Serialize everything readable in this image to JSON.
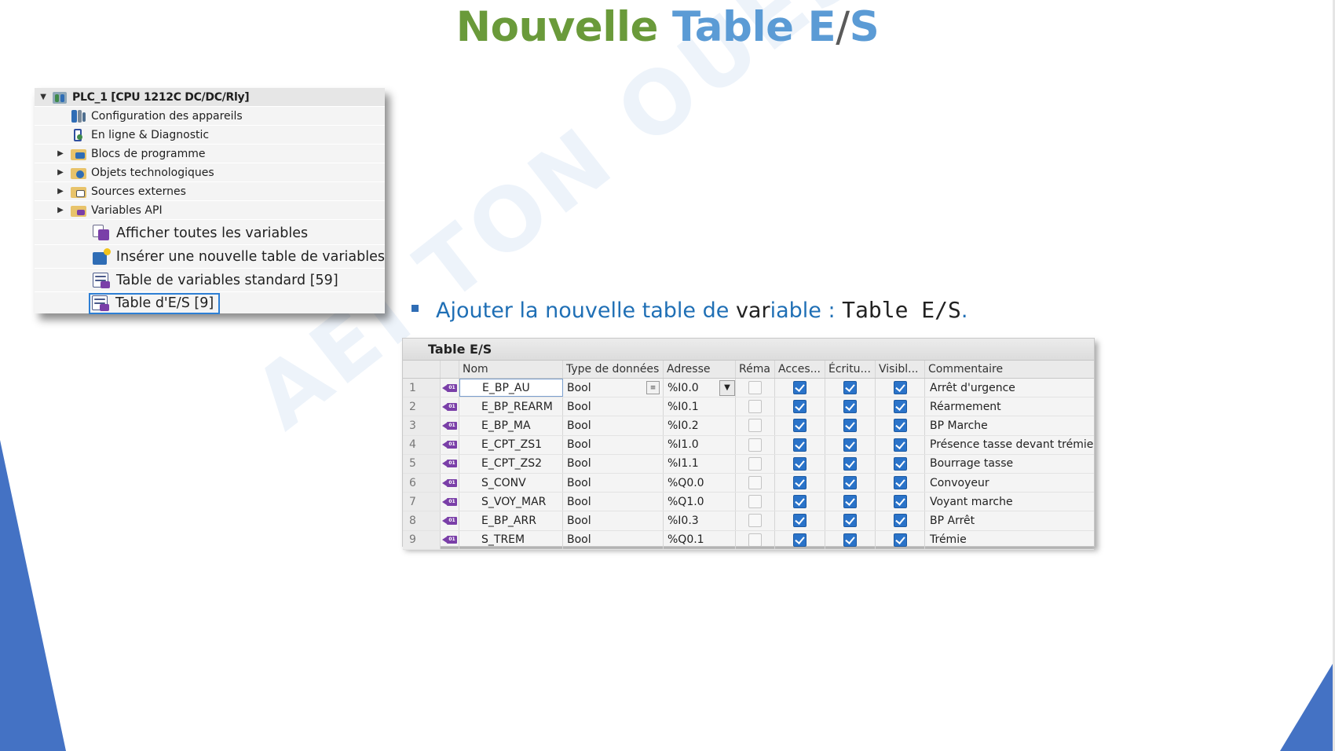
{
  "title": {
    "part1": "Nouvelle",
    "part2": "Table E",
    "slash": "/",
    "part3": "S"
  },
  "watermark": "AEI     TON  OUEST",
  "tree": {
    "root": "PLC_1 [CPU 1212C DC/DC/Rly]",
    "items": [
      {
        "label": "Configuration des appareils",
        "icon": "device-config-icon"
      },
      {
        "label": "En ligne & Diagnostic",
        "icon": "online-diagnostic-icon"
      },
      {
        "label": "Blocs de programme",
        "icon": "program-blocks-folder-icon"
      },
      {
        "label": "Objets technologiques",
        "icon": "technology-objects-folder-icon"
      },
      {
        "label": "Sources externes",
        "icon": "external-sources-folder-icon"
      },
      {
        "label": "Variables API",
        "icon": "plc-tags-folder-icon"
      }
    ],
    "subitems": [
      {
        "label": "Afficher toutes les variables",
        "icon": "show-all-tags-icon"
      },
      {
        "label": "Insérer une nouvelle table de variables",
        "icon": "add-tag-table-icon"
      },
      {
        "label": "Table de variables standard [59]",
        "icon": "tag-table-icon"
      },
      {
        "label": "Table d'E/S [9]",
        "icon": "tag-table-icon"
      }
    ]
  },
  "bullet": {
    "text1": "Ajouter la nouvelle table de ",
    "text2": "var",
    "text3": "iable : ",
    "code": "Table E/S",
    "end": "."
  },
  "table": {
    "title": "Table E/S",
    "headers": [
      "Nom",
      "Type de données",
      "Adresse",
      "Réma",
      "Acces...",
      "Écritu...",
      "Visibl...",
      "Commentaire"
    ],
    "rows": [
      {
        "n": "1",
        "name": "E_BP_AU",
        "type": "Bool",
        "addr": "%I0.0",
        "comment": "Arrêt d'urgence"
      },
      {
        "n": "2",
        "name": "E_BP_REARM",
        "type": "Bool",
        "addr": "%I0.1",
        "comment": "Réarmement"
      },
      {
        "n": "3",
        "name": "E_BP_MA",
        "type": "Bool",
        "addr": "%I0.2",
        "comment": "BP Marche"
      },
      {
        "n": "4",
        "name": "E_CPT_ZS1",
        "type": "Bool",
        "addr": "%I1.0",
        "comment": "Présence tasse devant trémie"
      },
      {
        "n": "5",
        "name": "E_CPT_ZS2",
        "type": "Bool",
        "addr": "%I1.1",
        "comment": "Bourrage tasse"
      },
      {
        "n": "6",
        "name": "S_CONV",
        "type": "Bool",
        "addr": "%Q0.0",
        "comment": "Convoyeur"
      },
      {
        "n": "7",
        "name": "S_VOY_MAR",
        "type": "Bool",
        "addr": "%Q1.0",
        "comment": "Voyant marche"
      },
      {
        "n": "8",
        "name": "E_BP_ARR",
        "type": "Bool",
        "addr": "%I0.3",
        "comment": "BP Arrêt"
      },
      {
        "n": "9",
        "name": "S_TREM",
        "type": "Bool",
        "addr": "%Q0.1",
        "comment": "Trémie"
      }
    ]
  },
  "colors": {
    "title_green": "#6a9a3a",
    "title_blue": "#5b9bd5",
    "accent": "#4472c4",
    "check_blue": "#2a73c9"
  }
}
